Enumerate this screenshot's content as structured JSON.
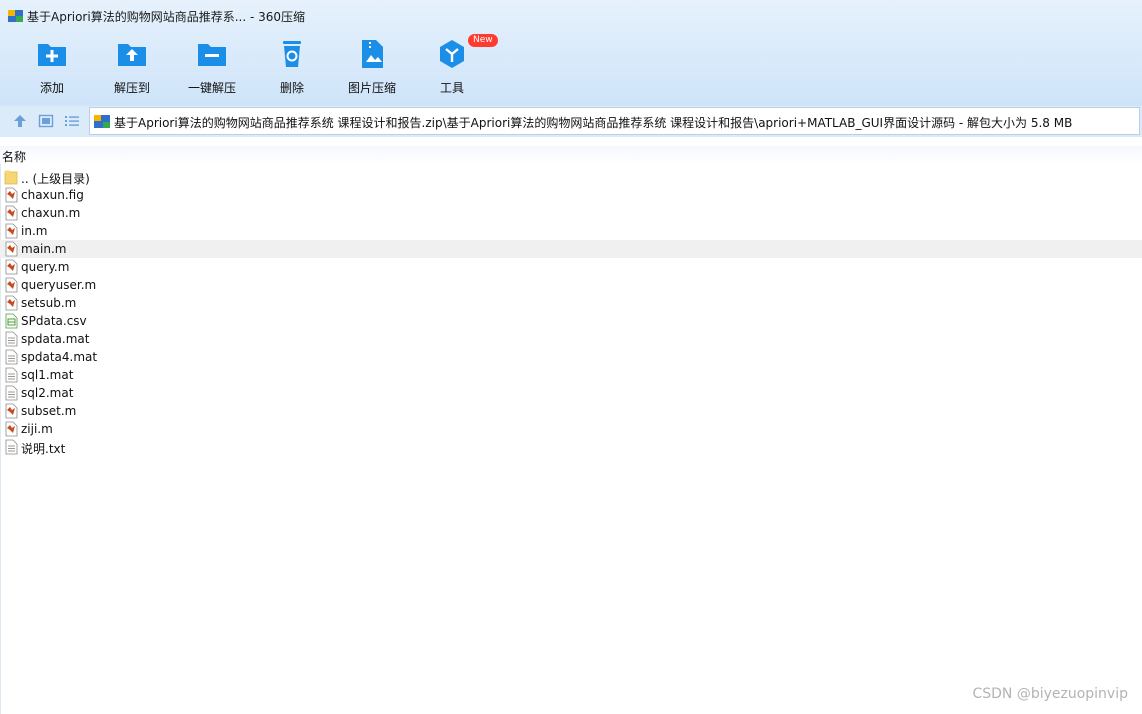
{
  "window": {
    "title": "基于Apriori算法的购物网站商品推荐系... - 360压缩"
  },
  "toolbar": {
    "items": [
      {
        "label": "添加",
        "icon": "add-folder-icon"
      },
      {
        "label": "解压到",
        "icon": "extract-to-icon"
      },
      {
        "label": "一键解压",
        "icon": "one-click-extract-icon"
      },
      {
        "label": "删除",
        "icon": "recycle-bin-icon"
      },
      {
        "label": "图片压缩",
        "icon": "image-compress-icon"
      },
      {
        "label": "工具",
        "icon": "tools-icon",
        "badge": "New"
      }
    ]
  },
  "address": {
    "path": "基于Apriori算法的购物网站商品推荐系统 课程设计和报告.zip\\基于Apriori算法的购物网站商品推荐系统 课程设计和报告\\apriori+MATLAB_GUI界面设计源码 - 解包大小为 5.8 MB"
  },
  "list": {
    "column_name": "名称",
    "files": [
      {
        "name": ".. (上级目录)",
        "type": "folder"
      },
      {
        "name": "chaxun.fig",
        "type": "matlab"
      },
      {
        "name": "chaxun.m",
        "type": "matlab"
      },
      {
        "name": "in.m",
        "type": "matlab"
      },
      {
        "name": "main.m",
        "type": "matlab",
        "selected": true
      },
      {
        "name": "query.m",
        "type": "matlab"
      },
      {
        "name": "queryuser.m",
        "type": "matlab"
      },
      {
        "name": "setsub.m",
        "type": "matlab"
      },
      {
        "name": "SPdata.csv",
        "type": "csv"
      },
      {
        "name": "spdata.mat",
        "type": "doc"
      },
      {
        "name": "spdata4.mat",
        "type": "doc"
      },
      {
        "name": "sql1.mat",
        "type": "doc"
      },
      {
        "name": "sql2.mat",
        "type": "doc"
      },
      {
        "name": "subset.m",
        "type": "matlab"
      },
      {
        "name": "ziji.m",
        "type": "matlab"
      },
      {
        "name": "说明.txt",
        "type": "doc"
      }
    ]
  },
  "watermark": "CSDN @biyezuopinvip",
  "colors": {
    "accent": "#1b8fe8",
    "badge": "#ff3b30"
  }
}
